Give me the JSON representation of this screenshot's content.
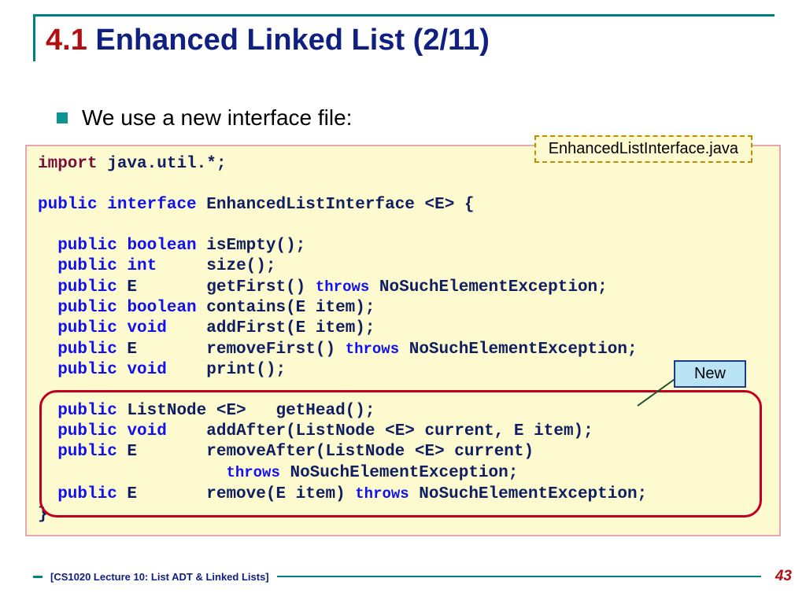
{
  "title": {
    "num": "4.1",
    "text": "Enhanced Linked List (2/11)"
  },
  "bullet": "We use a new interface file:",
  "fileBadge": "EnhancedListInterface.java",
  "newBadge": "New",
  "code": {
    "l1a": "import",
    "l1b": " java.util.*;",
    "l2a": "public",
    "l2b": " ",
    "l2c": "interface",
    "l2d": " EnhancedListInterface <E> {",
    "m1a": "  public",
    "m1b": " ",
    "m1c": "boolean",
    "m1d": " isEmpty();",
    "m2a": "  public",
    "m2b": " ",
    "m2c": "int",
    "m2d": "     size();",
    "m3a": "  public",
    "m3b": " E       getFirst() ",
    "m3c": "throws",
    "m3d": " NoSuchElementException;",
    "m4a": "  public",
    "m4b": " ",
    "m4c": "boolean",
    "m4d": " contains(E item);",
    "m5a": "  public",
    "m5b": " ",
    "m5c": "void",
    "m5d": "    addFirst(E item);",
    "m6a": "  public",
    "m6b": " E       removeFirst() ",
    "m6c": "throws",
    "m6d": " NoSuchElementException;",
    "m7a": "  public",
    "m7b": " ",
    "m7c": "void",
    "m7d": "    print();",
    "n1a": "  public",
    "n1b": " ListNode <E>   getHead();",
    "n2a": "  public",
    "n2b": " ",
    "n2c": "void",
    "n2d": "    addAfter(ListNode <E> current, E item);",
    "n3a": "  public",
    "n3b": " E       removeAfter(ListNode <E> current)",
    "n3c": "                   ",
    "n3d": "throws",
    "n3e": " NoSuchElementException;",
    "n4a": "  public",
    "n4b": " E       remove(E item) ",
    "n4c": "throws",
    "n4d": " NoSuchElementException;",
    "end": "}"
  },
  "footer": {
    "text": "[CS1020 Lecture 10: List ADT & Linked Lists]",
    "page": "43"
  }
}
